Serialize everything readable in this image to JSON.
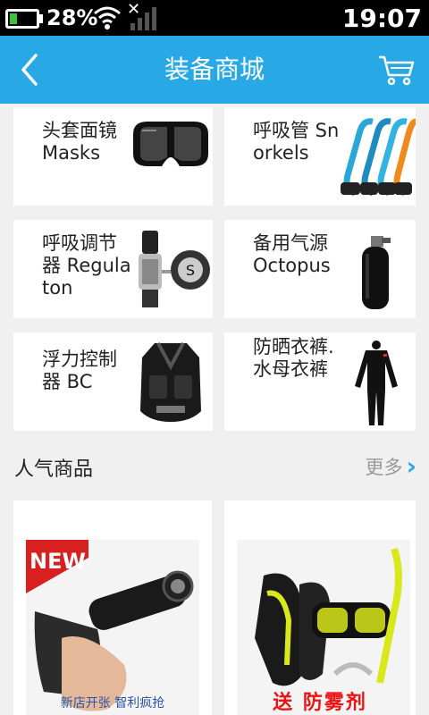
{
  "status_bar": {
    "battery_percent": "28%",
    "time": "19:07",
    "wifi_icon": "wifi-icon",
    "signal_icon": "signal-icon"
  },
  "header": {
    "title": "装备商城",
    "back_icon": "chevron-left-icon",
    "cart_icon": "cart-icon",
    "background": "#28a9e6"
  },
  "categories": [
    {
      "label": "头套面镜 Masks",
      "image": "dive-mask"
    },
    {
      "label": "呼吸管 Snorkels",
      "image": "snorkels"
    },
    {
      "label": "呼吸调节器 Regulaton",
      "image": "regulator"
    },
    {
      "label": "备用气源 Octopus",
      "image": "tank"
    },
    {
      "label": "浮力控制器 BC",
      "image": "bcd-vest"
    },
    {
      "label": "防晒衣裤.水母衣裤",
      "image": "wetsuit"
    }
  ],
  "popular": {
    "title": "人气商品",
    "more_label": "更多"
  },
  "products": [
    {
      "badge": "NEW",
      "caption": "新店开张    智利疯抢",
      "image": "dive-torch"
    },
    {
      "caption": "送   防雾剂",
      "image": "fins-mask-snorkel"
    }
  ]
}
